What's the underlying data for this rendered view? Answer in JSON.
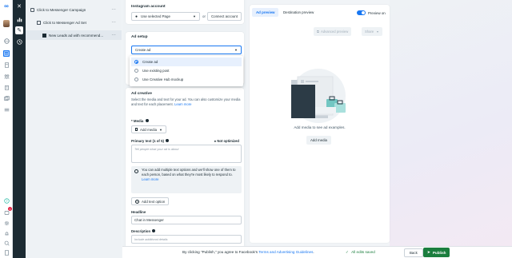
{
  "tree": {
    "campaign": "Click to Messenger Campaign",
    "adset": "Click to Messenger Ad Set",
    "ad": "New Leads ad with recommend..."
  },
  "instagram": {
    "label": "Instagram account",
    "select_value": "Use selected Page",
    "or": "or",
    "connect_button": "Connect account"
  },
  "ad_setup": {
    "label": "Ad setup",
    "select_value": "Create ad",
    "options": [
      "Create ad",
      "Use existing post",
      "Use Creative Hub mockup"
    ]
  },
  "ad_creative": {
    "label": "Ad creative",
    "desc": "Select the media and text for your ad. You can also customize your media and text for each placement.",
    "learn_more": "Learn more",
    "media_label": "* Media",
    "add_media": "Add media",
    "primary_text_label": "Primary text (1 of 5)",
    "not_optimized": "Not optimized",
    "primary_placeholder": "Tell people what your ad is about",
    "info_text": "You can add multiple text options and we'll show one of them to each person, based on what they're most likely to respond to.",
    "info_learn_more": "Learn more",
    "add_text_option": "Add text option",
    "headline_label": "Headline",
    "headline_value": "Chat in Messenger",
    "description_label": "Description",
    "description_placeholder": "Include additional details"
  },
  "preview": {
    "tab_ad_preview": "Ad preview",
    "tab_destination": "Destination preview",
    "toggle_label": "Preview on",
    "advanced_preview": "Advanced preview",
    "share": "Share",
    "empty_text": "Add media to see ad examples.",
    "add_media": "Add media"
  },
  "footer": {
    "terms_prefix": "By clicking \"Publish,\" you agree to Facebook's",
    "terms_link": "Terms and Advertising Guidelines",
    "terms_suffix": ".",
    "saved": "All edits saved",
    "back": "Back",
    "publish": "Publish"
  },
  "rail": {
    "notification_count": "1"
  },
  "colors": {
    "brand": "#1877f2",
    "dark_nav": "#1c2b33",
    "publish": "#1b7e3e",
    "saved": "#1b7e3e",
    "notification": "#e41e3f"
  }
}
